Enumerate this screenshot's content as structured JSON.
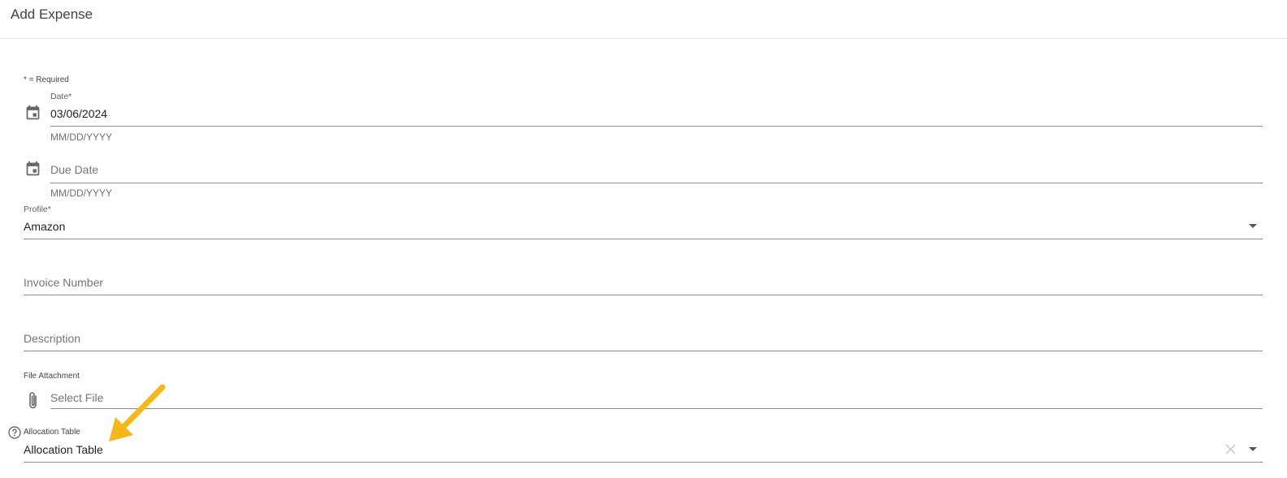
{
  "header": {
    "title": "Add Expense"
  },
  "form": {
    "required_note": "* = Required",
    "date": {
      "label": "Date*",
      "value": "03/06/2024",
      "hint": "MM/DD/YYYY"
    },
    "due_date": {
      "placeholder": "Due Date",
      "hint": "MM/DD/YYYY"
    },
    "profile": {
      "label": "Profile*",
      "value": "Amazon"
    },
    "invoice_number": {
      "placeholder": "Invoice Number"
    },
    "description": {
      "placeholder": "Description"
    },
    "file_attachment": {
      "label": "File Attachment",
      "placeholder": "Select File"
    },
    "allocation_table": {
      "label": "Allocation Table",
      "value": "Allocation Table"
    }
  },
  "icons": {
    "calendar": "calendar-icon",
    "paperclip": "paperclip-icon",
    "help": "help-circle-icon",
    "clear": "close-icon",
    "dropdown": "chevron-down-icon",
    "annotation": "arrow-icon"
  },
  "colors": {
    "annotation_arrow": "#F4B81C",
    "icon": "#6b6470"
  }
}
